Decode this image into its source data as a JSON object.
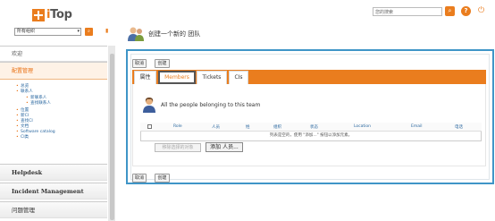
{
  "header": {
    "logo_i": "i",
    "logo_rest": "Top",
    "search_placeholder": "您的搜索",
    "search_icon": "search-icon",
    "help_icon": "?",
    "power_icon": "⏻"
  },
  "org_filter": {
    "selected": "所有组织",
    "go_icon": "search-icon"
  },
  "sidebar": {
    "welcome": "欢迎",
    "config_mgmt": "配置管理",
    "config_items_a": [
      "总览",
      "联系人"
    ],
    "config_items_b": [
      "新联系人",
      "查找联系人"
    ],
    "config_items_c": [
      "位置",
      "新CI",
      "查找CI",
      "文档",
      "Software catalog",
      "CI类"
    ],
    "helpdesk": "Helpdesk",
    "incident": "Incident Management",
    "problem": "问题管理"
  },
  "page": {
    "title": "创建一个新的 团队"
  },
  "buttons": {
    "cancel": "取消",
    "create": "创建"
  },
  "tabs": {
    "attributes": "属性",
    "members": "Members",
    "tickets": "Tickets",
    "cis": "CIs"
  },
  "members_tab": {
    "description": "All the people belonging to this team",
    "columns": [
      "Role",
      "人员",
      "姓",
      "组织",
      "状态",
      "Location",
      "Email",
      "电话"
    ],
    "empty_message": "列表是空的，使用 \"添加...\" 按钮以添加元素。",
    "remove_button": "移除选择的对象",
    "add_button": "添加 人员..."
  },
  "colors": {
    "accent": "#ea7d1e",
    "panel_border": "#3f95c7",
    "link": "#2b68a0"
  }
}
